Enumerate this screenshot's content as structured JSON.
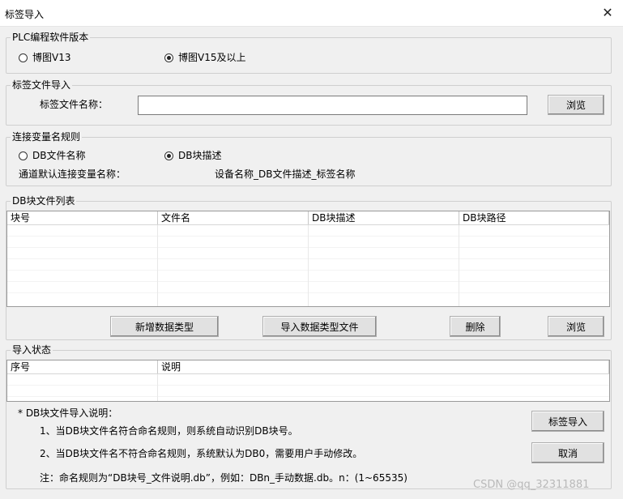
{
  "window": {
    "title": "标签导入",
    "close_glyph": "✕"
  },
  "plc_group": {
    "title": "PLC编程软件版本",
    "options": [
      {
        "label": "博图V13",
        "selected": false
      },
      {
        "label": "博图V15及以上",
        "selected": true
      }
    ]
  },
  "tag_file_group": {
    "title": "标签文件导入",
    "field_label": "标签文件名称：",
    "field_value": "",
    "browse_label": "浏览"
  },
  "rule_group": {
    "title": "连接变量名规则",
    "options": [
      {
        "label": "DB文件名称",
        "selected": false
      },
      {
        "label": "DB块描述",
        "selected": true
      }
    ],
    "default_label": "通道默认连接变量名称：",
    "default_value": "设备名称_DB文件描述_标签名称"
  },
  "db_list_group": {
    "title": "DB块文件列表",
    "columns": [
      "块号",
      "文件名",
      "DB块描述",
      "DB块路径"
    ],
    "rows": [],
    "buttons": {
      "add_type": "新增数据类型",
      "import_type": "导入数据类型文件",
      "delete": "删除",
      "browse": "浏览"
    }
  },
  "status_group": {
    "title": "导入状态",
    "columns": [
      "序号",
      "说明"
    ],
    "rows": []
  },
  "notes": {
    "heading": "* DB块文件导入说明：",
    "line1": "1、当DB块文件名符合命名规则，则系统自动识别DB块号。",
    "line2": "2、当DB块文件名不符合命名规则，系统默认为DB0，需要用户手动修改。",
    "line3": "注：命名规则为“DB块号_文件说明.db”，例如：DBn_手动数据.db。n：(1~65535)"
  },
  "actions": {
    "import_label": "标签导入",
    "cancel_label": "取消"
  },
  "watermark": "CSDN @qq_32311881"
}
